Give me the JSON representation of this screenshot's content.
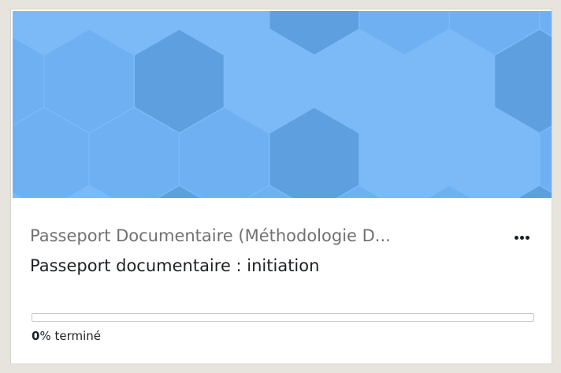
{
  "course_card": {
    "category": "Passeport Documentaire (Méthodologie D...",
    "course_name": "Passeport documentaire : initiation",
    "actions_icon": "more-horizontal-icon",
    "progress": {
      "percent": 0,
      "value_label": "0",
      "suffix_label": "% terminé"
    },
    "image": {
      "pattern": "hexagon-pattern",
      "colors": {
        "base": "#6eb0f2",
        "light": "#7cbaf7",
        "dark": "#5e9fe0"
      }
    }
  },
  "colors": {
    "page_background": "#e6e4dd",
    "card_background": "#ffffff",
    "text_primary": "#1d2125",
    "text_muted": "#717171"
  }
}
